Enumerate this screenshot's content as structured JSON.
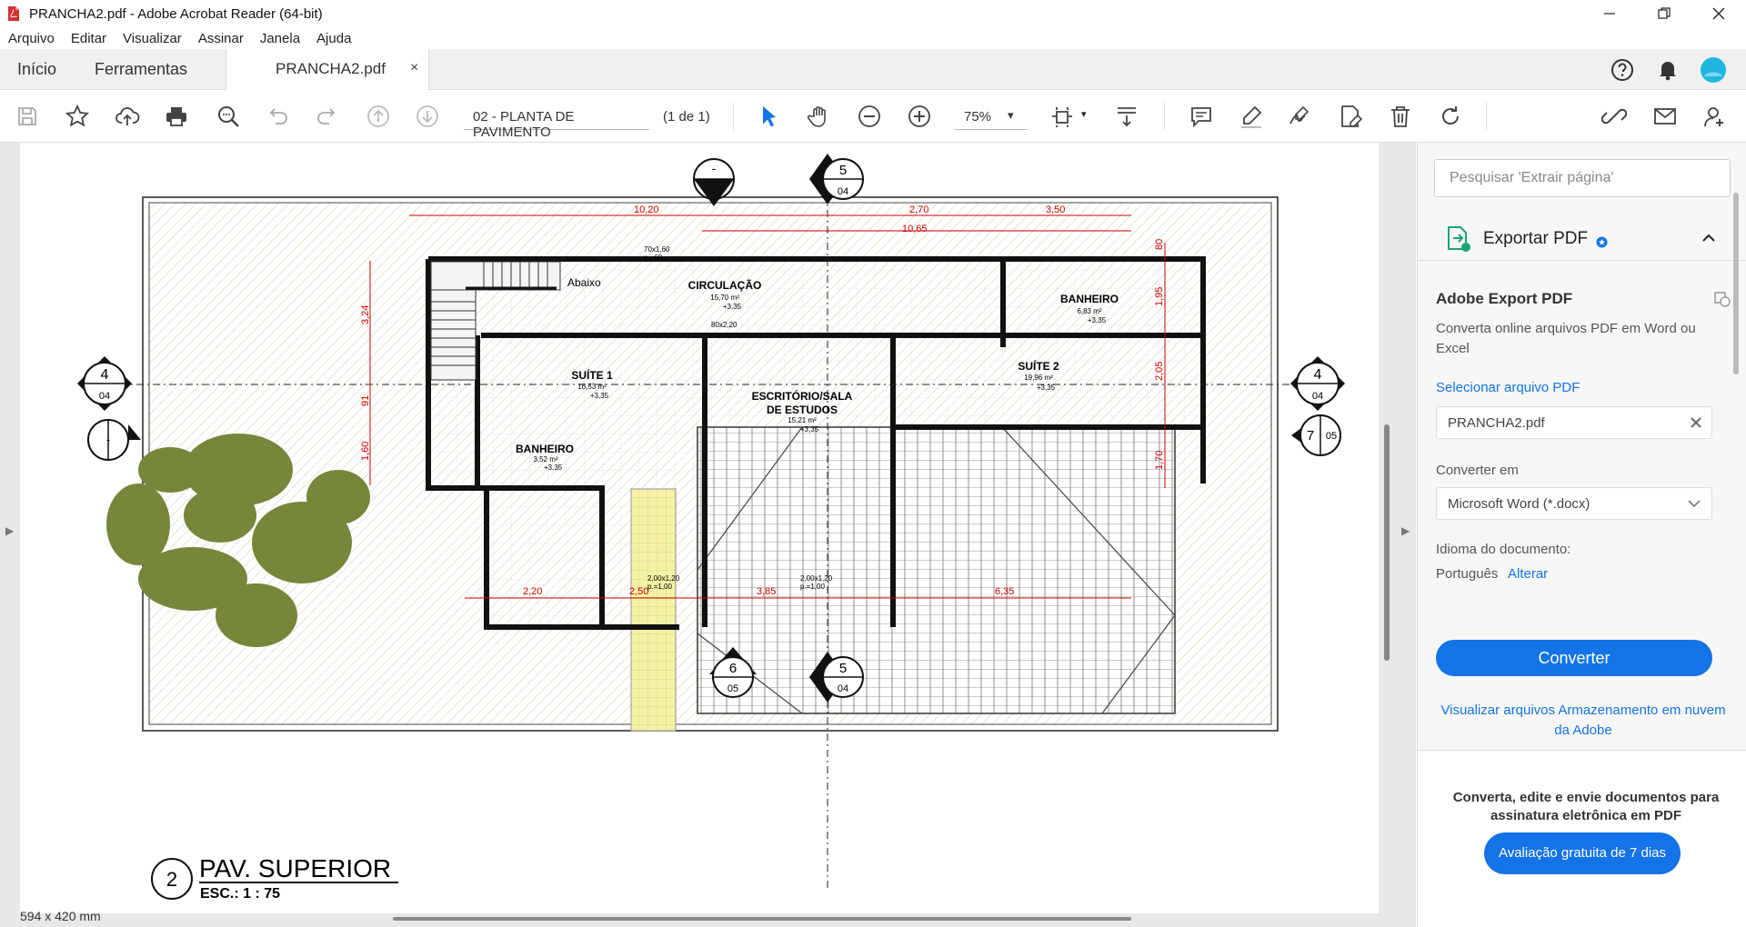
{
  "window": {
    "title": "PRANCHA2.pdf - Adobe Acrobat Reader (64-bit)",
    "minimize_icon": "minimize-icon",
    "restore_icon": "restore-icon",
    "close_icon": "close-icon"
  },
  "menu": [
    "Arquivo",
    "Editar",
    "Visualizar",
    "Assinar",
    "Janela",
    "Ajuda"
  ],
  "tabs": {
    "home": "Início",
    "tools": "Ferramentas",
    "document": "PRANCHA2.pdf",
    "close": "×"
  },
  "toolbar": {
    "page_label": "02 - PLANTA DE PAVIMENTO",
    "page_count": "(1 de 1)",
    "zoom": "75%",
    "zoom_caret": "▾"
  },
  "drawing": {
    "title": "PAV. SUPERIOR",
    "scale": "ESC.: 1 : 75",
    "number": "2",
    "rooms": [
      {
        "name": "CIRCULAÇÃO",
        "area": "15,70 m²",
        "level": "+3,35"
      },
      {
        "name": "SUÍTE 1",
        "area": "16,53 m²",
        "level": "+3,35"
      },
      {
        "name": "ESCRITÓRIO/SALA",
        "name2": "DE ESTUDOS",
        "area": "15,21 m²",
        "level": "+3,35"
      },
      {
        "name": "BANHEIRO",
        "area": "6,83 m²",
        "level": "+3,35"
      },
      {
        "name": "SUÍTE 2",
        "area": "19,96 m²",
        "level": "+3,35"
      },
      {
        "name": "BANHEIRO",
        "area": "3,52 m²",
        "level": "+3,35"
      }
    ],
    "abaixo": "Abaixo",
    "dims_top": [
      "10,20",
      "2,70",
      "3,50",
      "10,65"
    ],
    "dims_bottom": [
      "2,20",
      "2,50",
      "3,85",
      "6,35"
    ],
    "dims_left": [
      "3,24",
      "91",
      "1,60"
    ],
    "dims_right": [
      "80",
      "1,95",
      "2,05",
      "1,70"
    ],
    "sections": {
      "s4_left": {
        "num": "4",
        "sheet": "04"
      },
      "s4_right": {
        "num": "4",
        "sheet": "04"
      },
      "s5_top": {
        "num": "5",
        "sheet": "04"
      },
      "s5_bottom": {
        "num": "5",
        "sheet": "04"
      },
      "s6_bottom": {
        "num": "6",
        "sheet": "05"
      },
      "s7_right": {
        "num": "7",
        "sheet": "05"
      },
      "s_top_blank": "-",
      "s_left_blank": "-"
    },
    "windows": [
      "70x1,60",
      "p.=60"
    ],
    "doors": [
      "80x2,20",
      "2,00x1,20",
      "p.=1,00",
      "2,00x1,20",
      "p.=1,00"
    ]
  },
  "status": {
    "page_size": "594 x 420 mm"
  },
  "panel": {
    "search_placeholder": "Pesquisar 'Extrair página'",
    "export_title": "Exportar PDF",
    "section_title": "Adobe Export PDF",
    "description": "Converta online arquivos PDF em Word ou Excel",
    "select_file": "Selecionar arquivo PDF",
    "file_name": "PRANCHA2.pdf",
    "convert_to_label": "Converter em",
    "convert_to_value": "Microsoft Word (*.docx)",
    "language_label": "Idioma do documento:",
    "language_value": "Português",
    "language_change": "Alterar",
    "convert_button": "Converter",
    "cloud_link": "Visualizar arquivos Armazenamento em nuvem da Adobe",
    "promo_text": "Converta, edite e envie documentos para assinatura eletrônica em PDF",
    "promo_button": "Avaliação gratuita de 7 dias"
  }
}
